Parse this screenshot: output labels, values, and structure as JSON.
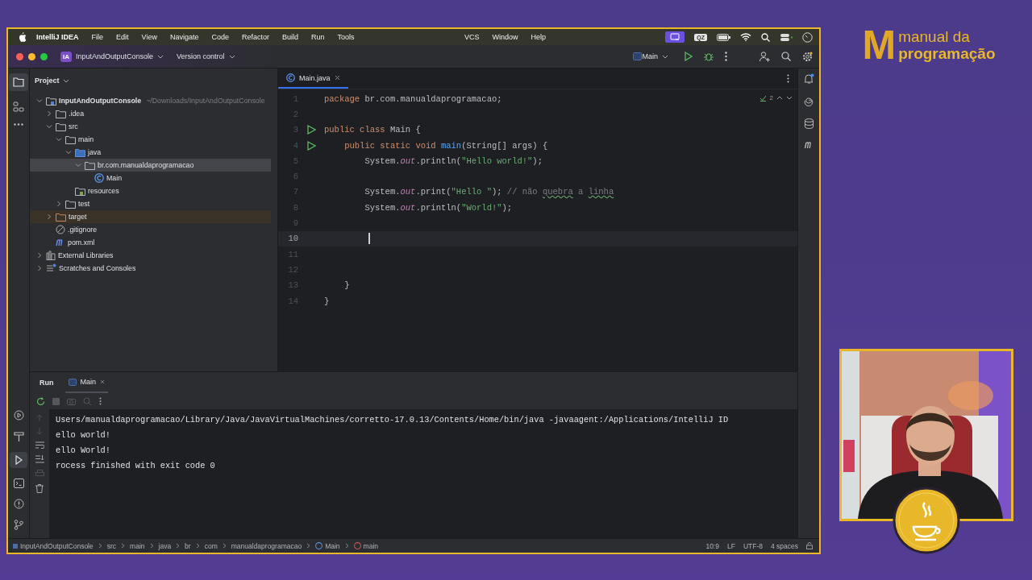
{
  "menubar": {
    "app": "IntelliJ IDEA",
    "items": [
      "File",
      "Edit",
      "View",
      "Navigate",
      "Code",
      "Refactor",
      "Build",
      "Run",
      "Tools",
      "VCS",
      "Window",
      "Help"
    ],
    "status_badge": "QZ"
  },
  "toolbar": {
    "project_badge": "IA",
    "project": "InputAndOutputConsole",
    "vcs": "Version control",
    "run_config": "Main"
  },
  "project_panel": {
    "title": "Project",
    "tree": [
      {
        "name": "InputAndOutputConsole",
        "hint": "~/Downloads/InputAndOutputConsole",
        "kind": "project",
        "expanded": true,
        "selected": false,
        "children": [
          {
            "name": ".idea",
            "kind": "folder",
            "expanded": false,
            "selected": false
          },
          {
            "name": "src",
            "kind": "folder",
            "expanded": true,
            "selected": false,
            "children": [
              {
                "name": "main",
                "kind": "folder",
                "expanded": true,
                "selected": false,
                "children": [
                  {
                    "name": "java",
                    "kind": "source",
                    "expanded": true,
                    "selected": false,
                    "children": [
                      {
                        "name": "br.com.manualdaprogramacao",
                        "kind": "package",
                        "expanded": true,
                        "selected": true,
                        "children": [
                          {
                            "name": "Main",
                            "kind": "class",
                            "selected": false
                          }
                        ]
                      }
                    ]
                  },
                  {
                    "name": "resources",
                    "kind": "resources",
                    "selected": false
                  }
                ]
              },
              {
                "name": "test",
                "kind": "folder",
                "expanded": false,
                "selected": false
              }
            ]
          },
          {
            "name": "target",
            "kind": "excluded",
            "expanded": false,
            "selected": false
          },
          {
            "name": ".gitignore",
            "kind": "ignore",
            "selected": false
          },
          {
            "name": "pom.xml",
            "kind": "maven",
            "selected": false
          }
        ]
      },
      {
        "name": "External Libraries",
        "kind": "libraries",
        "expanded": false,
        "selected": false
      },
      {
        "name": "Scratches and Consoles",
        "kind": "scratches",
        "expanded": false,
        "selected": false
      }
    ]
  },
  "editor": {
    "tab": "Main.java",
    "inspections": "2",
    "lines": [
      {
        "number": "1",
        "runnable": false,
        "current": false,
        "tokens": [
          {
            "kind": "kw",
            "text": "package"
          },
          {
            "kind": "plain",
            "text": " br.com.manualdaprogramacao;"
          }
        ]
      },
      {
        "number": "2",
        "runnable": false,
        "current": false
      },
      {
        "number": "3",
        "runnable": true,
        "current": false,
        "tokens": [
          {
            "kind": "kw",
            "text": "public class"
          },
          {
            "kind": "plain",
            "text": " Main {"
          }
        ]
      },
      {
        "number": "4",
        "runnable": true,
        "current": false,
        "tokens": [
          {
            "kind": "kw",
            "text": "    public static void"
          },
          {
            "kind": "method",
            "text": " main"
          },
          {
            "kind": "plain",
            "text": "(String[] args) {"
          }
        ]
      },
      {
        "number": "5",
        "runnable": false,
        "current": false,
        "tokens": [
          {
            "kind": "plain",
            "text": "        System."
          },
          {
            "kind": "field",
            "text": "out"
          },
          {
            "kind": "plain",
            "text": ".println("
          },
          {
            "kind": "str",
            "text": "\"Hello world!\""
          },
          {
            "kind": "plain",
            "text": ");"
          }
        ]
      },
      {
        "number": "6",
        "runnable": false,
        "current": false
      },
      {
        "number": "7",
        "runnable": false,
        "current": false,
        "tokens": [
          {
            "kind": "plain",
            "text": "        System."
          },
          {
            "kind": "field",
            "text": "out"
          },
          {
            "kind": "plain",
            "text": ".print("
          },
          {
            "kind": "str",
            "text": "\"Hello \""
          },
          {
            "kind": "plain",
            "text": "); "
          },
          {
            "kind": "comment",
            "text": "// não "
          },
          {
            "kind": "typo",
            "text": "quebra"
          },
          {
            "kind": "comment",
            "text": " a "
          },
          {
            "kind": "typo",
            "text": "linha"
          }
        ]
      },
      {
        "number": "8",
        "runnable": false,
        "current": false,
        "tokens": [
          {
            "kind": "plain",
            "text": "        System."
          },
          {
            "kind": "field",
            "text": "out"
          },
          {
            "kind": "plain",
            "text": ".println("
          },
          {
            "kind": "str",
            "text": "\"World!\""
          },
          {
            "kind": "plain",
            "text": ");"
          }
        ]
      },
      {
        "number": "9",
        "runnable": false,
        "current": false
      },
      {
        "number": "10",
        "runnable": false,
        "current": true
      },
      {
        "number": "11",
        "runnable": false,
        "current": false
      },
      {
        "number": "12",
        "runnable": false,
        "current": false
      },
      {
        "number": "13",
        "runnable": false,
        "current": false,
        "tokens": [
          {
            "kind": "plain",
            "text": "    }"
          }
        ]
      },
      {
        "number": "14",
        "runnable": false,
        "current": false,
        "tokens": [
          {
            "kind": "plain",
            "text": "}"
          }
        ]
      }
    ]
  },
  "run_panel": {
    "tabs": [
      {
        "label": "Run",
        "selected": false
      },
      {
        "label": "Main",
        "selected": true
      }
    ],
    "output": [
      "Users/manualdaprogramacao/Library/Java/JavaVirtualMachines/corretto-17.0.13/Contents/Home/bin/java -javaagent:/Applications/IntelliJ ID",
      "ello world!",
      "ello World!",
      "rocess finished with exit code 0"
    ]
  },
  "status_bar": {
    "breadcrumbs": [
      {
        "kind": "module",
        "text": "InputAndOutputConsole"
      },
      {
        "kind": "dir",
        "text": "src"
      },
      {
        "kind": "dir",
        "text": "main"
      },
      {
        "kind": "dir",
        "text": "java"
      },
      {
        "kind": "dir",
        "text": "br"
      },
      {
        "kind": "dir",
        "text": "com"
      },
      {
        "kind": "dir",
        "text": "manualdaprogramacao"
      },
      {
        "kind": "class",
        "text": "Main"
      },
      {
        "kind": "method",
        "text": "main"
      }
    ],
    "position": "10:9",
    "line_ending": "LF",
    "encoding": "UTF-8",
    "indent": "4 spaces"
  },
  "branding": {
    "mark": "M",
    "line1": "manual da",
    "line2": "programação"
  }
}
